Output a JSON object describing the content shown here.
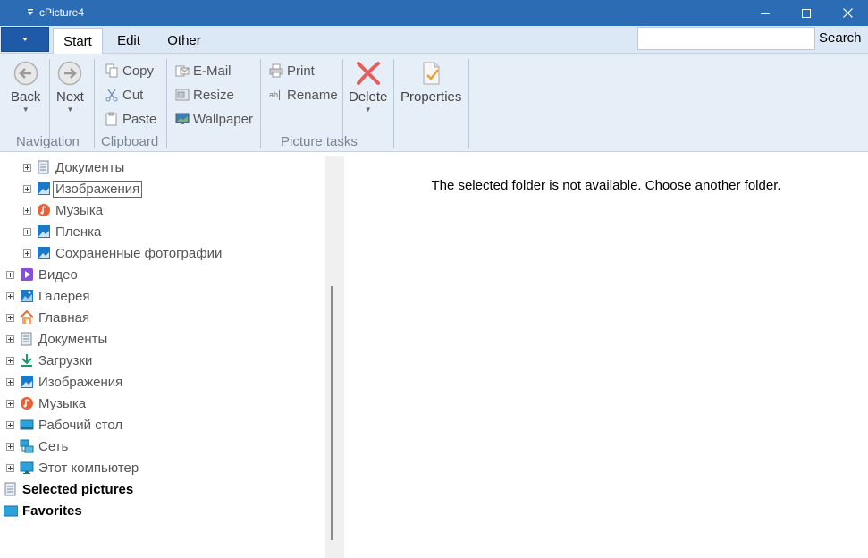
{
  "window": {
    "title": "cPicture4"
  },
  "ribbon_tabs": [
    {
      "label": "Start"
    },
    {
      "label": "Edit"
    },
    {
      "label": "Other"
    }
  ],
  "search": {
    "value": "",
    "label": "Search"
  },
  "ribbon": {
    "navigation": {
      "group_label": "Navigation",
      "back_label": "Back",
      "next_label": "Next"
    },
    "clipboard": {
      "group_label": "Clipboard",
      "copy_label": "Copy",
      "cut_label": "Cut",
      "paste_label": "Paste"
    },
    "picture_tasks": {
      "group_label": "Picture tasks",
      "email_label": "E-Mail",
      "resize_label": "Resize",
      "wallpaper_label": "Wallpaper",
      "print_label": "Print",
      "rename_label": "Rename",
      "delete_label": "Delete",
      "properties_label": "Properties"
    }
  },
  "tree": {
    "sub_items": [
      {
        "label": "Документы",
        "icon": "document-icon"
      },
      {
        "label": "Изображения",
        "icon": "picture-icon"
      },
      {
        "label": "Музыка",
        "icon": "music-icon"
      },
      {
        "label": "Пленка",
        "icon": "picture-icon"
      },
      {
        "label": "Сохраненные фотографии",
        "icon": "picture-icon"
      }
    ],
    "items": [
      {
        "label": "Видео",
        "icon": "video-icon"
      },
      {
        "label": "Галерея",
        "icon": "gallery-icon"
      },
      {
        "label": "Главная",
        "icon": "home-icon"
      },
      {
        "label": "Документы",
        "icon": "document-icon"
      },
      {
        "label": "Загрузки",
        "icon": "download-icon"
      },
      {
        "label": "Изображения",
        "icon": "picture-icon"
      },
      {
        "label": "Музыка",
        "icon": "music-icon"
      },
      {
        "label": "Рабочий стол",
        "icon": "desktop-icon"
      },
      {
        "label": "Сеть",
        "icon": "network-icon"
      },
      {
        "label": "Этот компьютер",
        "icon": "computer-icon"
      }
    ],
    "selected_pictures_label": "Selected pictures",
    "favorites_label": "Favorites"
  },
  "content": {
    "message": "The selected folder is not available. Choose another folder."
  },
  "colors": {
    "titlebar": "#2b6cb5",
    "ribbon_bg": "#e6eef8",
    "tabs_bg": "#dce8f6",
    "accent_blue": "#1e78c8",
    "delete_red": "#e05050"
  }
}
